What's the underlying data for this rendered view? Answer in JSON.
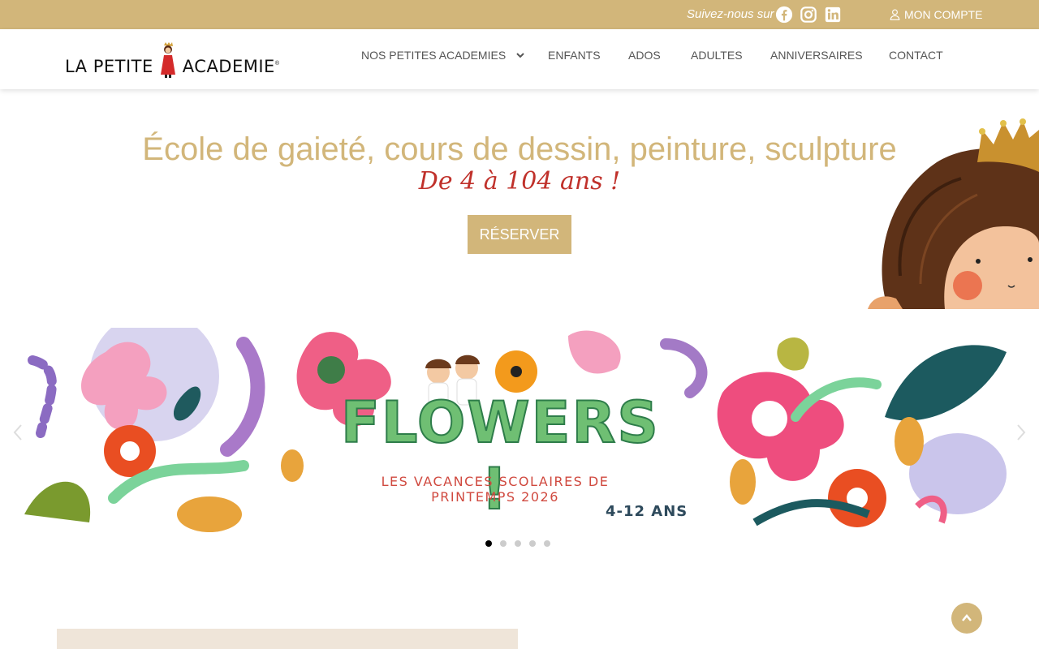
{
  "topbar": {
    "follow_text": "Suivez-nous sur",
    "social": [
      "facebook-icon",
      "instagram-icon",
      "linkedin-icon"
    ],
    "account_label": "MON COMPTE"
  },
  "header": {
    "logo_left": "LA PETITE",
    "logo_right": "ACADEMIE",
    "nav": [
      {
        "label": "NOS PETITES ACADEMIES",
        "has_dropdown": true
      },
      {
        "label": "ENFANTS"
      },
      {
        "label": "ADOS"
      },
      {
        "label": "ADULTES"
      },
      {
        "label": "ANNIVERSAIRES"
      },
      {
        "label": "CONTACT"
      }
    ]
  },
  "hero": {
    "title": "École de gaieté, cours de dessin, peinture, sculpture",
    "subtitle": "De 4 à 104 ans !",
    "cta_label": "RÉSERVER"
  },
  "carousel": {
    "title": "FLOWERS !",
    "subtitle": "LES VACANCES SCOLAIRES DE PRINTEMPS 2026",
    "age": "4-12 ANS",
    "slide_count": 5,
    "active_index": 0
  },
  "colors": {
    "gold": "#d2b67a",
    "red": "#c0312b",
    "beige": "#efe5d9"
  }
}
